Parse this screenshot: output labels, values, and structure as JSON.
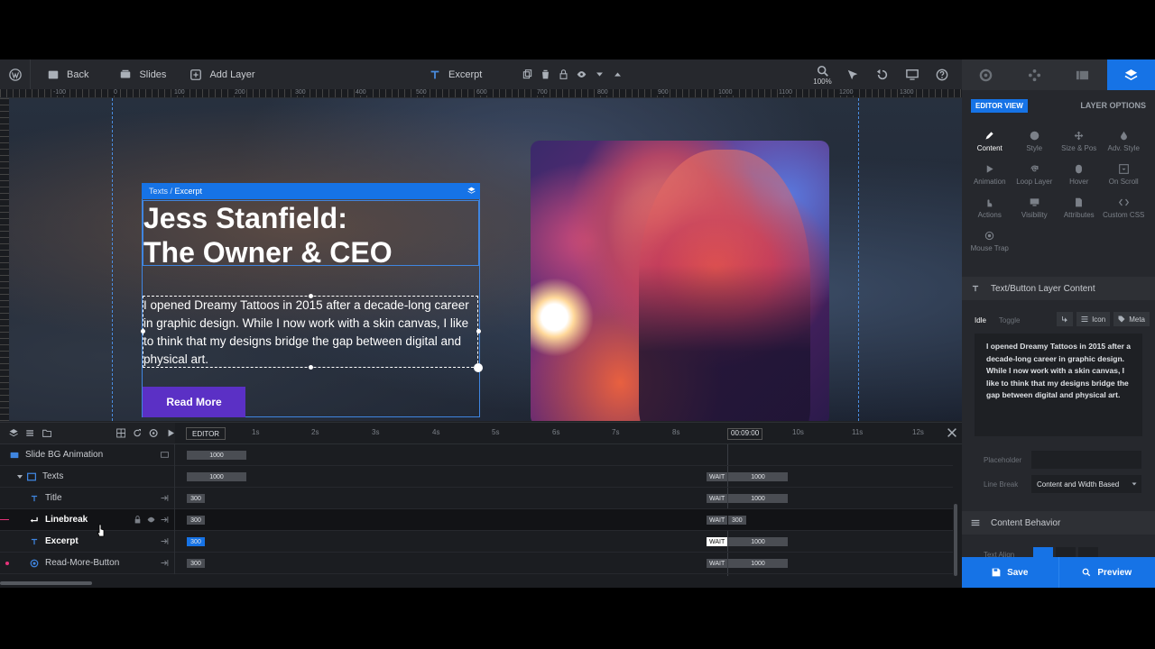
{
  "toolbar": {
    "back_label": "Back",
    "slides_label": "Slides",
    "add_layer_label": "Add Layer",
    "current_layer_label": "Excerpt",
    "zoom_label": "100%"
  },
  "ruler": {
    "ticks": [
      "-100",
      "0",
      "100",
      "200",
      "300",
      "400",
      "500",
      "600",
      "700",
      "800",
      "900",
      "1000",
      "1100",
      "1200",
      "1300"
    ]
  },
  "canvas": {
    "breadcrumb_parent": "Texts",
    "breadcrumb_sep": " / ",
    "breadcrumb_current": "Excerpt",
    "title_line1": "Jess Stanfield:",
    "title_line2": "The Owner & CEO",
    "excerpt_text": "I opened Dreamy Tattoos in 2015 after a decade-long career in graphic design. While I now work with a skin canvas, I like to think that my designs bridge the gap between digital and physical art.",
    "button_label": "Read More"
  },
  "timeline": {
    "editor_label": "EDITOR",
    "ticks": [
      "1s",
      "2s",
      "3s",
      "4s",
      "5s",
      "6s",
      "7s",
      "8s",
      "10s",
      "11s",
      "12s"
    ],
    "current_time": "00:09:00",
    "rows": [
      {
        "name": "Slide BG Animation",
        "bar": "1000",
        "wait": "",
        "end": ""
      },
      {
        "name": "Texts",
        "bar": "1000",
        "wait": "WAIT",
        "end": "1000"
      },
      {
        "name": "Title",
        "bar": "300",
        "wait": "WAIT",
        "end": "1000"
      },
      {
        "name": "Linebreak",
        "bar": "300",
        "wait": "WAIT",
        "end": "300"
      },
      {
        "name": "Excerpt",
        "bar": "300",
        "wait": "WAIT",
        "end": "1000"
      },
      {
        "name": "Read-More-Button",
        "bar": "300",
        "wait": "WAIT",
        "end": "1000"
      }
    ]
  },
  "panel": {
    "editor_view_label": "EDITOR VIEW",
    "layer_options_label": "LAYER OPTIONS",
    "options": [
      {
        "label": "Content",
        "icon": "pen-icon"
      },
      {
        "label": "Style",
        "icon": "palette-icon"
      },
      {
        "label": "Size & Pos",
        "icon": "move-icon"
      },
      {
        "label": "Adv. Style",
        "icon": "drop-icon"
      },
      {
        "label": "Animation",
        "icon": "play-icon"
      },
      {
        "label": "Loop Layer",
        "icon": "loop-icon"
      },
      {
        "label": "Hover",
        "icon": "mouse-icon"
      },
      {
        "label": "On Scroll",
        "icon": "scroll-icon"
      },
      {
        "label": "Actions",
        "icon": "hand-icon"
      },
      {
        "label": "Visibility",
        "icon": "monitor-icon"
      },
      {
        "label": "Attributes",
        "icon": "file-icon"
      },
      {
        "label": "Custom CSS",
        "icon": "code-icon"
      },
      {
        "label": "Mouse Trap",
        "icon": "target-icon"
      }
    ],
    "content_section_title": "Text/Button Layer Content",
    "idle_label": "Idle",
    "toggle_label": "Toggle",
    "icon_btn_label": "Icon",
    "meta_btn_label": "Meta",
    "content_text": "I opened Dreamy Tattoos in 2015 after a decade-long career in graphic design. While I now work with a skin canvas, I like to think that my designs bridge the gap between digital and physical art.",
    "placeholder_label": "Placeholder",
    "placeholder_value": "",
    "line_break_label": "Line Break",
    "line_break_value": "Content and Width Based",
    "behavior_section_title": "Content Behavior",
    "text_align_label": "Text Align",
    "save_label": "Save",
    "preview_label": "Preview"
  },
  "colors": {
    "accent": "#1673e6",
    "button": "#5b30c5",
    "marker": "#e6337a"
  }
}
